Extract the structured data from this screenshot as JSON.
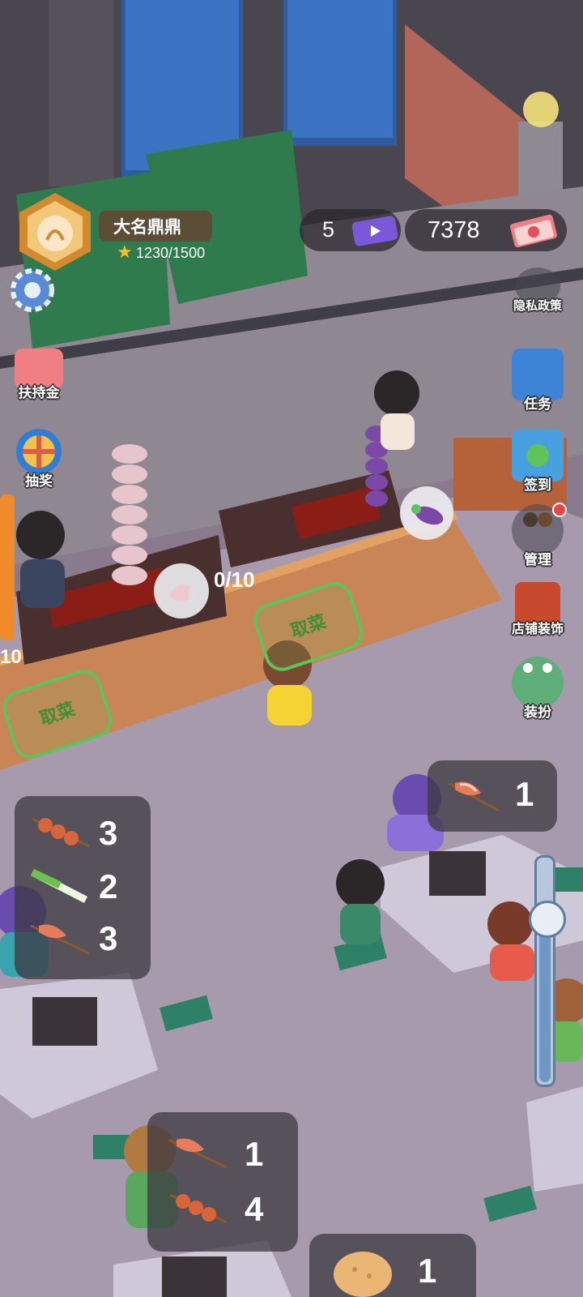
{
  "player": {
    "name": "大名鼎鼎",
    "xp": "1230/1500"
  },
  "currency": {
    "tickets": "5",
    "cash": "7378"
  },
  "left_menu": {
    "subsidy_label": "扶持金",
    "lottery_label": "抽奖"
  },
  "right_menu": {
    "privacy_label": "隐私政策",
    "tasks_label": "任务",
    "checkin_label": "签到",
    "manage_label": "管理",
    "decor_label": "店铺装饰",
    "dressup_label": "装扮"
  },
  "grill": {
    "counter_text": "0/10",
    "left_counter_text": "10"
  },
  "pickup_zones": {
    "label_1": "取菜",
    "label_2": "取菜"
  },
  "orders": {
    "top_right": {
      "bacon": "1"
    },
    "left_table": {
      "meat_skewer": "3",
      "leek": "2",
      "bacon": "3"
    },
    "bottom_table": {
      "bacon": "1",
      "meat_skewer": "4"
    },
    "bottom_right": {
      "bread": "1"
    }
  },
  "zoom": {
    "level": 0.78
  },
  "colors": {
    "hud_bg": "#2a262c",
    "pickup_green": "#5fc25a",
    "floor": "#a89aad",
    "street": "#8f8791"
  }
}
